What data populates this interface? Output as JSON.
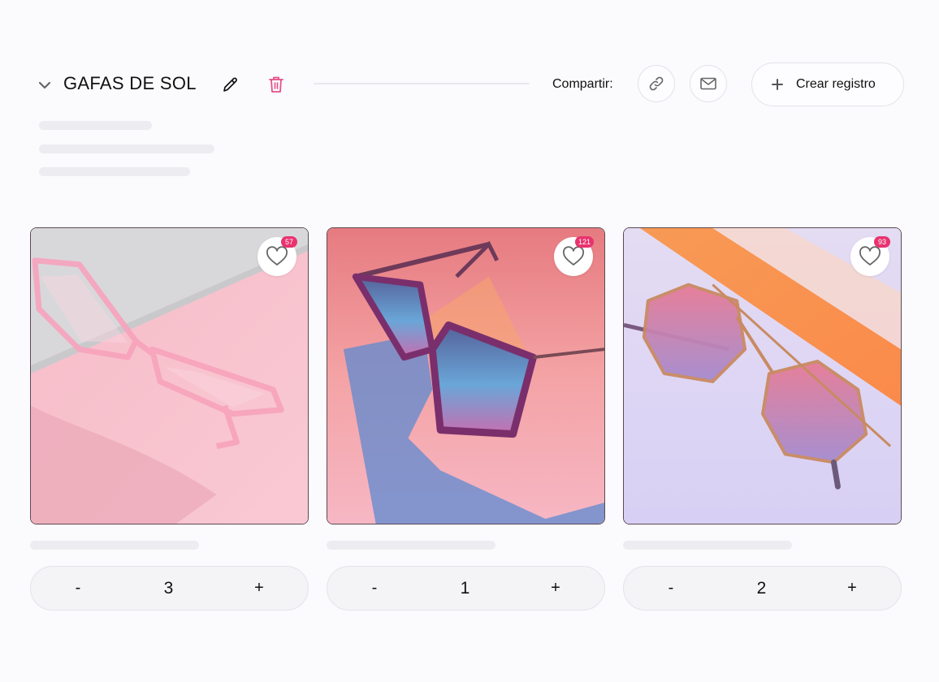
{
  "header": {
    "title": "GAFAS DE SOL",
    "share_label": "Compartir:",
    "create_label": "Crear registro"
  },
  "icons": {
    "collapse": "chevron-down-icon",
    "edit": "pencil-icon",
    "delete": "trash-icon",
    "share_link": "link-icon",
    "share_email": "mail-icon",
    "add": "plus-icon",
    "favorite": "heart-icon"
  },
  "colors": {
    "accent": "#e8336f",
    "trash": "#e64f86",
    "border": "#e3e3ea",
    "skeleton": "#ededf1"
  },
  "products": [
    {
      "favorites": "57",
      "quantity": "3",
      "minus": "-",
      "plus": "+"
    },
    {
      "favorites": "121",
      "quantity": "1",
      "minus": "-",
      "plus": "+"
    },
    {
      "favorites": "93",
      "quantity": "2",
      "minus": "-",
      "plus": "+"
    }
  ]
}
